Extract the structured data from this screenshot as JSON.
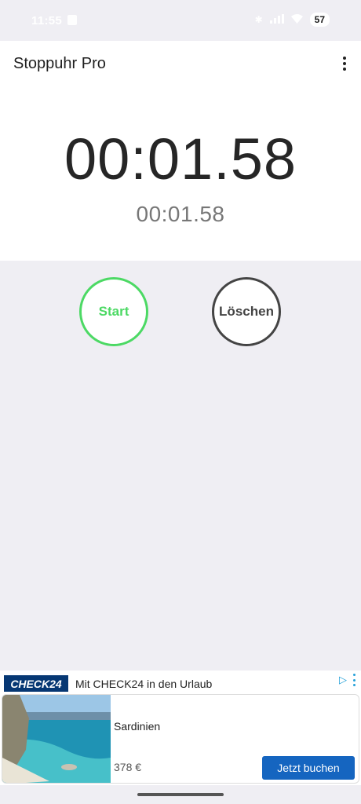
{
  "status_bar": {
    "time": "11:55",
    "battery": "57",
    "icons": [
      "calendar-icon",
      "bluetooth-icon",
      "signal-icon",
      "wifi-icon",
      "battery-icon"
    ]
  },
  "app": {
    "title": "Stoppuhr Pro",
    "menu_icon": "more-vert-icon"
  },
  "stopwatch": {
    "main_time": "00:01.58",
    "lap_time": "00:01.58"
  },
  "controls": {
    "start_label": "Start",
    "clear_label": "Löschen",
    "start_color": "#4cd964",
    "clear_color": "#444444"
  },
  "ad": {
    "brand": "CHECK24",
    "headline": "Mit CHECK24 in den Urlaub",
    "destination": "Sardinien",
    "price": "378 €",
    "cta": "Jetzt buchen",
    "brand_color": "#063773",
    "cta_color": "#1565c0"
  }
}
